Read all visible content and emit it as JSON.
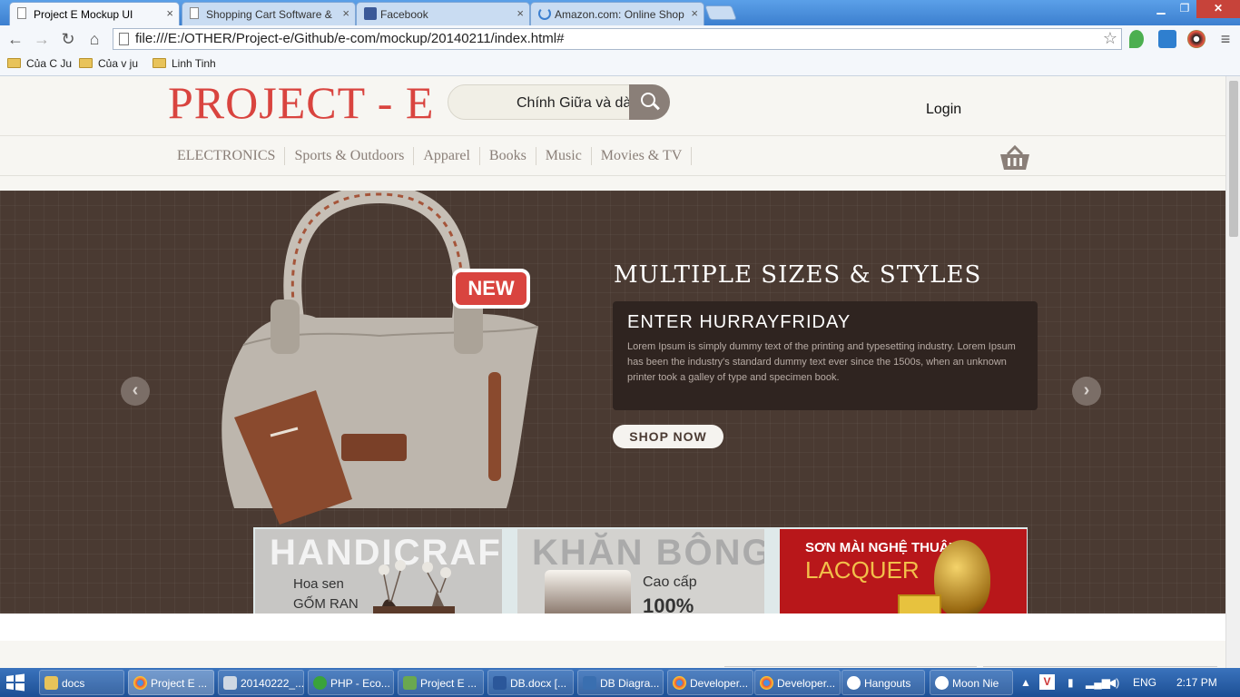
{
  "browser": {
    "tabs": [
      {
        "title": "Project E Mockup UI",
        "active": true
      },
      {
        "title": "Shopping Cart Software &",
        "active": false
      },
      {
        "title": "Facebook",
        "active": false
      },
      {
        "title": "Amazon.com: Online Shop",
        "active": false
      }
    ],
    "url": "file:///E:/OTHER/Project-e/Github/e-com/mockup/20140211/index.html#",
    "bookmarks": [
      "Của C Ju",
      "Của v ju",
      "Linh Tinh"
    ]
  },
  "site": {
    "logo": "PROJECT - E",
    "search_value": "Chính Giữa và dài hơn",
    "login": "Login",
    "categories": [
      "ELECTRONICS",
      "Sports & Outdoors",
      "Apparel",
      "Books",
      "Music",
      "Movies & TV"
    ]
  },
  "hero": {
    "badge": "NEW",
    "headline": "MULTIPLE SIZES & STYLES",
    "promo_title": "ENTER HURRAYFRIDAY",
    "promo_body": "Lorem Ipsum is simply dummy text of the printing and typesetting industry. Lorem Ipsum has been the industry's standard dummy text ever since the 1500s, when an unknown printer took a galley of type and specimen book.",
    "cta": "SHOP NOW",
    "prev": "‹",
    "next": "›"
  },
  "tiles": [
    {
      "big": "HANDICRAFTS",
      "line1": "Hoa sen",
      "line2": "GỐM RAN"
    },
    {
      "big": "KHĂN BÔNG",
      "line1": "Cao cấp",
      "line2": "100%"
    },
    {
      "line1": "SƠN MÀI NGHỆ THUẬT",
      "line2": "LACQUER"
    }
  ],
  "taskbar": {
    "items": [
      "docs",
      "Project E ...",
      "20140222_...",
      "PHP - Eco...",
      "Project E ...",
      "DB.docx [...",
      "DB Diagra...",
      "Developer...",
      "Developer...",
      "Hangouts",
      "Moon Nie"
    ],
    "lang": "ENG",
    "clock": "2:17 PM"
  },
  "colors": {
    "brand": "#d9443f",
    "hero_bg": "#4a3a32",
    "accent_text": "#8a7f78"
  }
}
